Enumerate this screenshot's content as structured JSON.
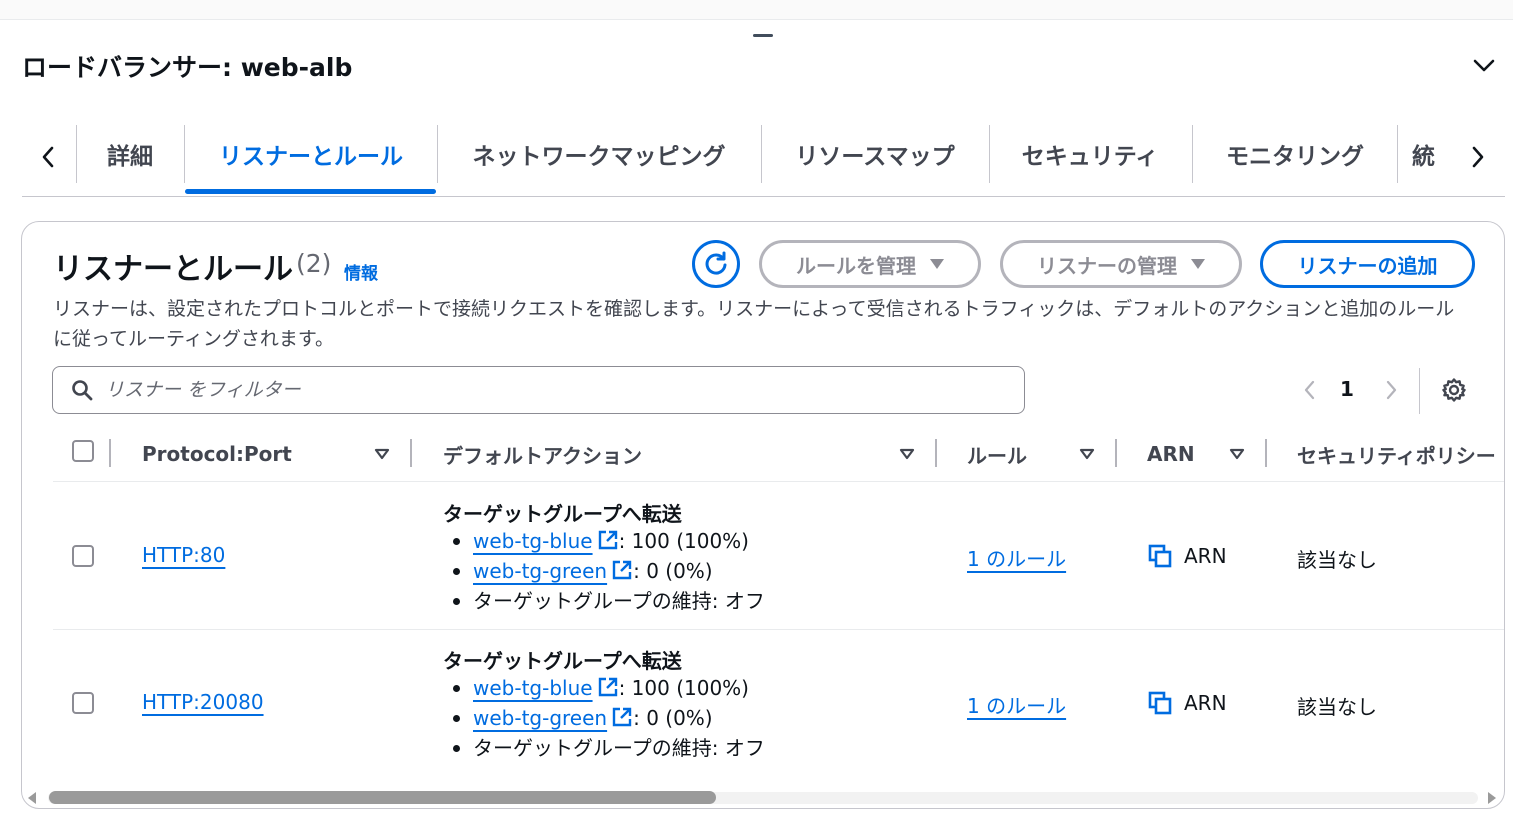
{
  "panel": {
    "title": "ロードバランサー: web-alb"
  },
  "tabs": [
    {
      "label": "詳細"
    },
    {
      "label": "リスナーとルール"
    },
    {
      "label": "ネットワークマッピング"
    },
    {
      "label": "リソースマップ"
    },
    {
      "label": "セキュリティ"
    },
    {
      "label": "モニタリング"
    },
    {
      "label": "統"
    }
  ],
  "active_tab": "リスナーとルール",
  "section": {
    "title": "リスナーとルール",
    "count": "(2)",
    "info_link": "情報",
    "description": "リスナーは、設定されたプロトコルとポートで接続リクエストを確認します。リスナーによって受信されるトラフィックは、デフォルトのアクションと追加のルールに従ってルーティングされます。"
  },
  "actions": {
    "manage_rules": "ルールを管理",
    "manage_listener": "リスナーの管理",
    "add_listener": "リスナーの追加"
  },
  "search": {
    "placeholder": "リスナー をフィルター"
  },
  "pagination": {
    "current_page": "1"
  },
  "table": {
    "columns": [
      "Protocol:Port",
      "デフォルトアクション",
      "ルール",
      "ARN",
      "セキュリティポリシー"
    ],
    "rows": [
      {
        "protocol_port": "HTTP:80",
        "action_title": "ターゲットグループへ転送",
        "tg1_name": "web-tg-blue",
        "tg1_weight": ": 100 (100%)",
        "tg2_name": "web-tg-green",
        "tg2_weight": ": 0 (0%)",
        "stickiness": "ターゲットグループの維持: オフ",
        "rules": "1 のルール",
        "arn": "ARN",
        "security_policy": "該当なし"
      },
      {
        "protocol_port": "HTTP:20080",
        "action_title": "ターゲットグループへ転送",
        "tg1_name": "web-tg-blue",
        "tg1_weight": ": 100 (100%)",
        "tg2_name": "web-tg-green",
        "tg2_weight": ": 0 (0%)",
        "stickiness": "ターゲットグループの維持: オフ",
        "rules": "1 のルール",
        "arn": "ARN",
        "security_policy": "該当なし"
      }
    ]
  },
  "colors": {
    "accent": "#006ce0",
    "text": "#0f141a",
    "muted": "#424650",
    "border": "#c6c6cd"
  },
  "icons": [
    "chevron-down-icon",
    "chevron-left-icon",
    "chevron-right-icon",
    "refresh-icon",
    "caret-down-icon",
    "search-icon",
    "settings-icon",
    "external-link-icon",
    "copy-icon",
    "sort-caret-icon"
  ]
}
